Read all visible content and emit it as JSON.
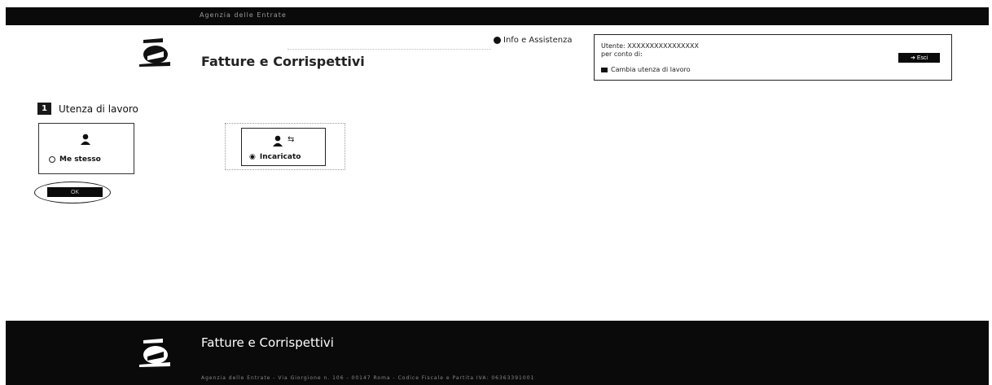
{
  "topbar": {
    "agency": "Agenzia delle Entrate"
  },
  "header": {
    "title": "Fatture e Corrispettivi",
    "info_link": "Info e Assistenza"
  },
  "user": {
    "user_line": "Utente: XXXXXXXXXXXXXXXX",
    "for_line": "per conto di:",
    "change_label": "Cambia utenza di lavoro",
    "exit_label": "Esci"
  },
  "step": {
    "number": "1",
    "label": "Utenza di lavoro"
  },
  "options": {
    "me": {
      "label": "Me stesso"
    },
    "incaricato": {
      "label": "Incaricato"
    }
  },
  "ok_button": "OK",
  "footer": {
    "title": "Fatture e Corrispettivi",
    "text": "Agenzia delle Entrate - Via Giorgione n. 106 - 00147 Roma - Codice Fiscale e Partita IVA: 06363391001"
  },
  "icons": {
    "logo": "agenzia-logo",
    "info": "info-icon",
    "change": "folder-icon",
    "exit": "exit-icon",
    "person": "person-icon",
    "arrows": "swap-icon"
  }
}
